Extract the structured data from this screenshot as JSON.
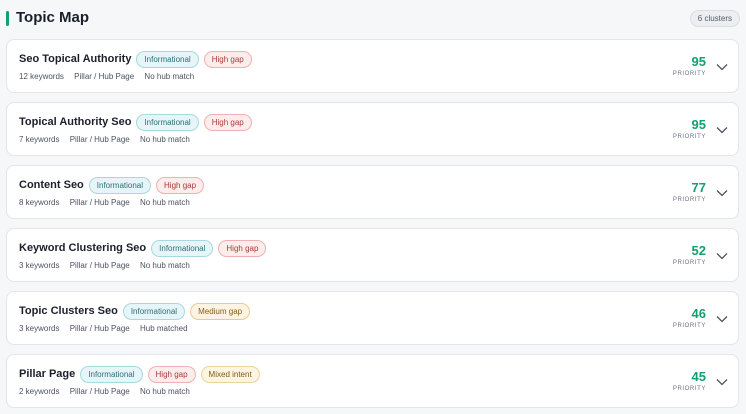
{
  "header": {
    "title": "Topic Map",
    "count_badge": "6 clusters"
  },
  "colors": {
    "accent": "#13a06f",
    "score": "#13a06f"
  },
  "topics": [
    {
      "title": "Seo Topical Authority",
      "tags": [
        "Informational",
        "High gap"
      ],
      "keywords": "12 keywords",
      "page_type": "Pillar / Hub Page",
      "hub_status": "No hub match",
      "score": "95",
      "score_label": "PRIORITY"
    },
    {
      "title": "Topical Authority Seo",
      "tags": [
        "Informational",
        "High gap"
      ],
      "keywords": "7 keywords",
      "page_type": "Pillar / Hub Page",
      "hub_status": "No hub match",
      "score": "95",
      "score_label": "PRIORITY"
    },
    {
      "title": "Content Seo",
      "tags": [
        "Informational",
        "High gap"
      ],
      "keywords": "8 keywords",
      "page_type": "Pillar / Hub Page",
      "hub_status": "No hub match",
      "score": "77",
      "score_label": "PRIORITY"
    },
    {
      "title": "Keyword Clustering Seo",
      "tags": [
        "Informational",
        "High gap"
      ],
      "keywords": "3 keywords",
      "page_type": "Pillar / Hub Page",
      "hub_status": "No hub match",
      "score": "52",
      "score_label": "PRIORITY"
    },
    {
      "title": "Topic Clusters Seo",
      "tags": [
        "Informational",
        "Medium gap"
      ],
      "keywords": "3 keywords",
      "page_type": "Pillar / Hub Page",
      "hub_status": "Hub matched",
      "score": "46",
      "score_label": "PRIORITY"
    },
    {
      "title": "Pillar Page",
      "tags": [
        "Informational",
        "High gap",
        "Mixed intent"
      ],
      "keywords": "2 keywords",
      "page_type": "Pillar / Hub Page",
      "hub_status": "No hub match",
      "score": "45",
      "score_label": "PRIORITY"
    }
  ],
  "icons": {
    "expand": "chevron-down-icon"
  }
}
